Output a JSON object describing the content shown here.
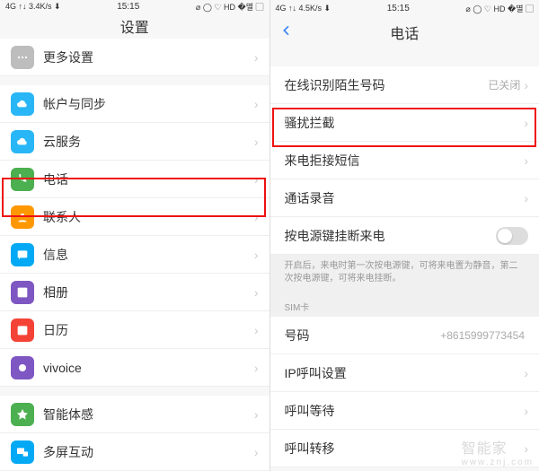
{
  "left": {
    "status": {
      "left": "4G ↑↓ 3.4K/s ⬇",
      "center": "15:15",
      "right": "⌀ ◯ ♡ HD �멸 ▢"
    },
    "title": "设置",
    "items": [
      {
        "icon": "more",
        "label": "更多设置",
        "color": "#bdbdbd"
      },
      {
        "gap": true
      },
      {
        "icon": "cloud",
        "label": "帐户与同步",
        "color": "#29b6f6"
      },
      {
        "icon": "cloud2",
        "label": "云服务",
        "color": "#29b6f6"
      },
      {
        "icon": "phone",
        "label": "电话",
        "color": "#4caf50"
      },
      {
        "icon": "contact",
        "label": "联系人",
        "color": "#ff9800"
      },
      {
        "icon": "msg",
        "label": "信息",
        "color": "#03a9f4"
      },
      {
        "icon": "album",
        "label": "相册",
        "color": "#7e57c2"
      },
      {
        "icon": "cal",
        "label": "日历",
        "color": "#f44336"
      },
      {
        "icon": "voice",
        "label": "vivoice",
        "color": "#7e57c2"
      },
      {
        "gap": true
      },
      {
        "icon": "sense",
        "label": "智能体感",
        "color": "#4caf50"
      },
      {
        "icon": "multi",
        "label": "多屏互动",
        "color": "#03a9f4"
      }
    ]
  },
  "right": {
    "status": {
      "left": "4G ↑↓ 4.5K/s ⬇",
      "center": "15:15",
      "right": "⌀ ◯ ♡ HD �멸 ▢"
    },
    "title": "电话",
    "rows": [
      {
        "label": "在线识别陌生号码",
        "value": "已关闭",
        "chev": true
      },
      {
        "label": "骚扰拦截",
        "chev": true
      },
      {
        "label": "来电拒接短信",
        "chev": true
      },
      {
        "label": "通话录音",
        "chev": true
      },
      {
        "label": "按电源键挂断来电",
        "toggle": true
      }
    ],
    "hint": "开启后，来电时第一次按电源键，可将来电置为静音，第二次按电源键，可将来电挂断。",
    "sim_header": "SIM卡",
    "sim_rows": [
      {
        "label": "号码",
        "value": "+8615999773454"
      },
      {
        "label": "IP呼叫设置",
        "chev": true
      },
      {
        "label": "呼叫等待",
        "chev": true
      },
      {
        "label": "呼叫转移",
        "chev": true
      }
    ]
  },
  "watermark": {
    "t1": "智能家",
    "t2": "www.znj.com"
  }
}
